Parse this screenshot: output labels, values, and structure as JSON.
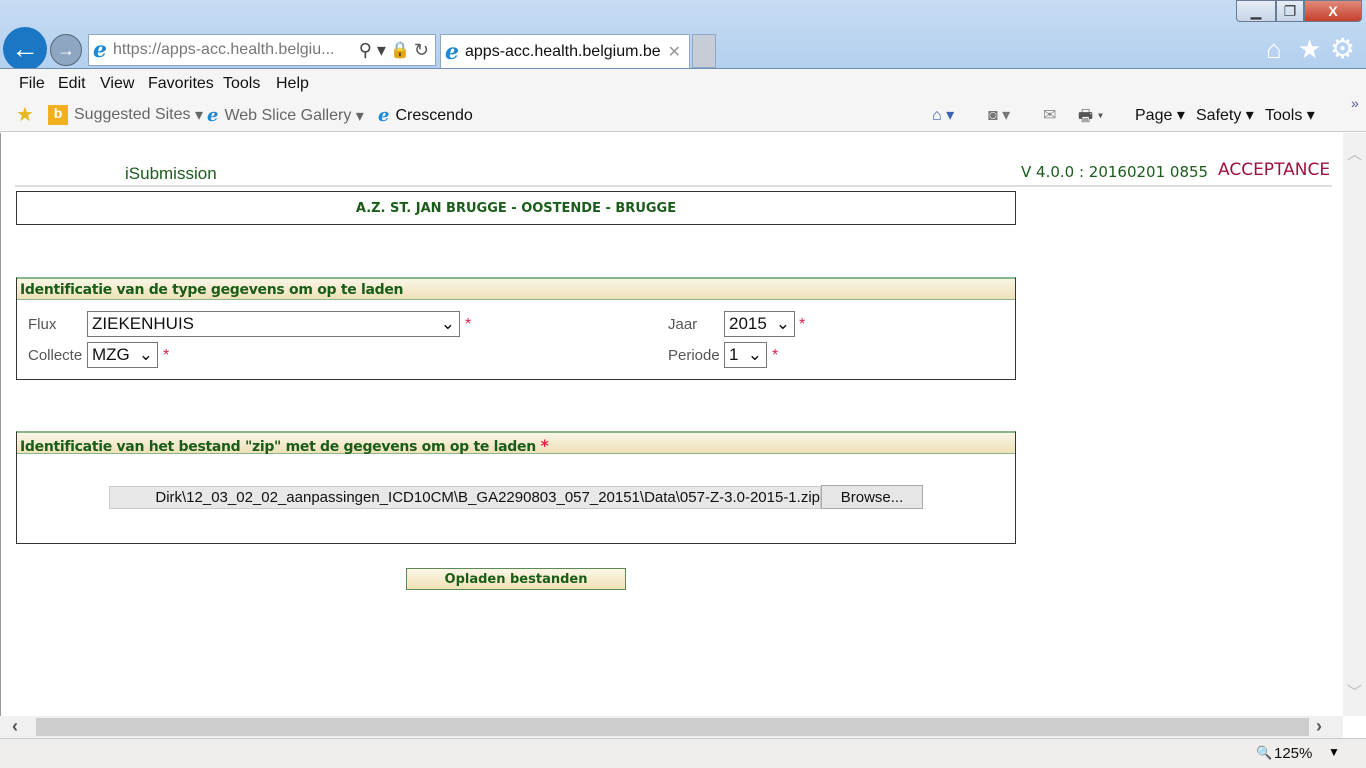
{
  "browser": {
    "address_url": "https://apps-acc.health.belgiu...",
    "tab_title": "apps-acc.health.belgium.be",
    "menu": [
      "File",
      "Edit",
      "View",
      "Favorites",
      "Tools",
      "Help"
    ],
    "favorites": [
      "Suggested Sites",
      "Web Slice Gallery",
      "Crescendo"
    ],
    "commands": [
      "Page",
      "Safety",
      "Tools"
    ],
    "zoom": "125%"
  },
  "app": {
    "name": "iSubmission",
    "version": "V 4.0.0 : 20160201 0855",
    "environment": "ACCEPTANCE",
    "institution": "A.Z. ST. JAN BRUGGE - OOSTENDE - BRUGGE"
  },
  "section1": {
    "title": "Identificatie van de type gegevens om op te laden",
    "flux_label": "Flux",
    "flux_value": "ZIEKENHUIS",
    "collecte_label": "Collecte",
    "collecte_value": "MZG",
    "jaar_label": "Jaar",
    "jaar_value": "2015",
    "periode_label": "Periode",
    "periode_value": "1",
    "required_mark": "*"
  },
  "section2": {
    "title": "Identificatie van het bestand \"zip\" met de gegevens om op te laden",
    "required_mark": "*",
    "file_path": "Dirk\\12_03_02_02_aanpassingen_ICD10CM\\B_GA2290803_057_20151\\Data\\057-Z-3.0-2015-1.zip",
    "browse_label": "Browse..."
  },
  "upload_label": "Opladen bestanden",
  "colors": {
    "green": "#1a5c1a",
    "acceptance": "#a0103a",
    "required": "#e0204a"
  }
}
